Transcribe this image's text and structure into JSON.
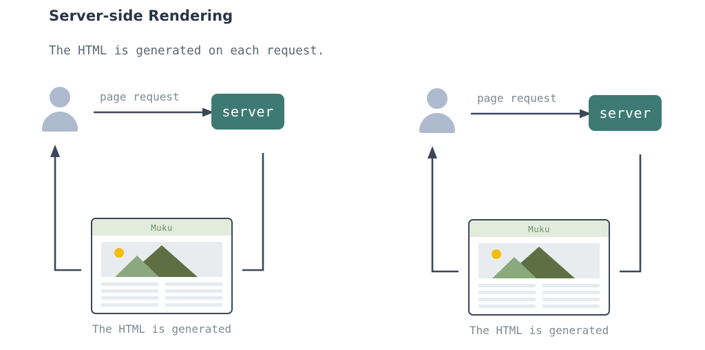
{
  "header": {
    "title": "Server-side Rendering",
    "subtitle": "The HTML is generated on each request."
  },
  "colors": {
    "background": "#ffffff",
    "title_text": "#2b3445",
    "body_text": "#5e6672",
    "muted_text": "#808891",
    "server_box": "#3d7a73",
    "server_label": "#ffffff",
    "user_icon": "#aebacd",
    "connector_line": "#3c4658",
    "browser_border": "#3c4658",
    "browser_titlebar": "#e3ebdd",
    "browser_title_text": "#6d9461",
    "hero_background": "#e8ecee",
    "sun": "#f5bd0e",
    "mountain_front": "#8aa97c",
    "mountain_back": "#5e7043",
    "text_line": "#e7ebee"
  },
  "flows": [
    {
      "id": "left",
      "user_icon": "user-person-icon",
      "request_label": "page request",
      "server_label": "server",
      "browser": {
        "title": "Muku",
        "hero_icon": "mountain-landscape-image",
        "sun_icon": "sun-icon",
        "text_line_rows": 4,
        "text_line_columns": 2
      },
      "caption": "The HTML is generated"
    },
    {
      "id": "right",
      "user_icon": "user-person-icon",
      "request_label": "page request",
      "server_label": "server",
      "browser": {
        "title": "Muku",
        "hero_icon": "mountain-landscape-image",
        "sun_icon": "sun-icon",
        "text_line_rows": 4,
        "text_line_columns": 2
      },
      "caption": "The HTML is generated"
    }
  ]
}
